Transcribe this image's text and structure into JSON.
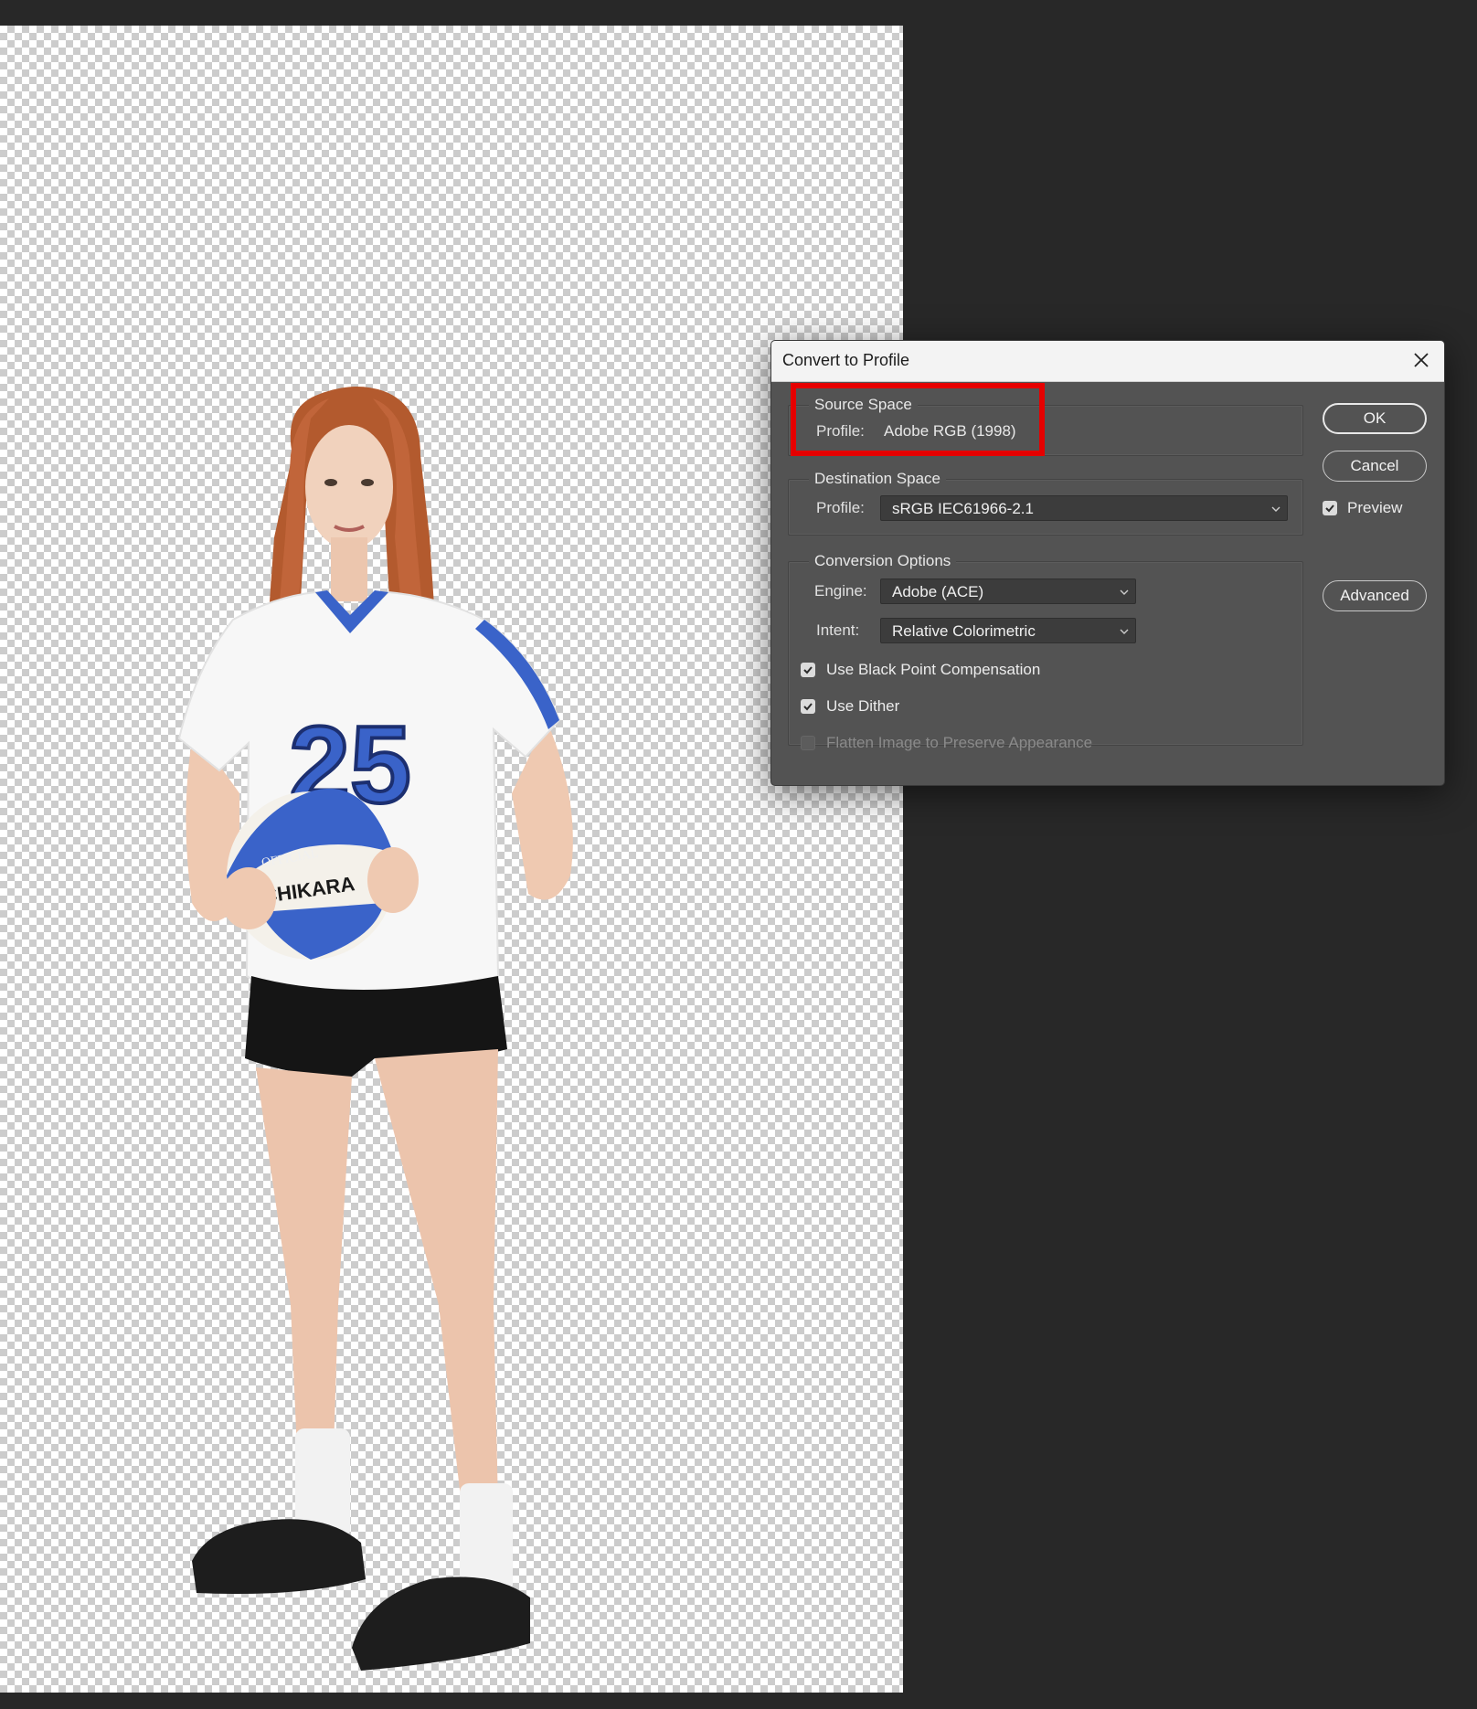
{
  "dialog": {
    "title": "Convert to Profile",
    "source_space": {
      "legend": "Source Space",
      "profile_label": "Profile:",
      "profile_value": "Adobe RGB (1998)"
    },
    "destination_space": {
      "legend": "Destination Space",
      "profile_label": "Profile:",
      "profile_value": "sRGB IEC61966-2.1"
    },
    "conversion_options": {
      "legend": "Conversion Options",
      "engine_label": "Engine:",
      "engine_value": "Adobe (ACE)",
      "intent_label": "Intent:",
      "intent_value": "Relative Colorimetric",
      "black_point": {
        "label": "Use Black Point Compensation",
        "checked": true
      },
      "dither": {
        "label": "Use Dither",
        "checked": true
      },
      "flatten": {
        "label": "Flatten Image to Preserve Appearance",
        "checked": false,
        "disabled": true
      }
    },
    "buttons": {
      "ok": "OK",
      "cancel": "Cancel",
      "advanced": "Advanced"
    },
    "preview": {
      "label": "Preview",
      "checked": true
    }
  },
  "canvas": {
    "ball_text": "TACHIKARA",
    "ball_small_text": "OFFICIAL",
    "jersey_number": "25"
  },
  "annotation": {
    "color": "#e60000"
  },
  "colors": {
    "workspace": "#282828",
    "dialog": "#535353",
    "jersey_blue": "#3a63c9"
  }
}
